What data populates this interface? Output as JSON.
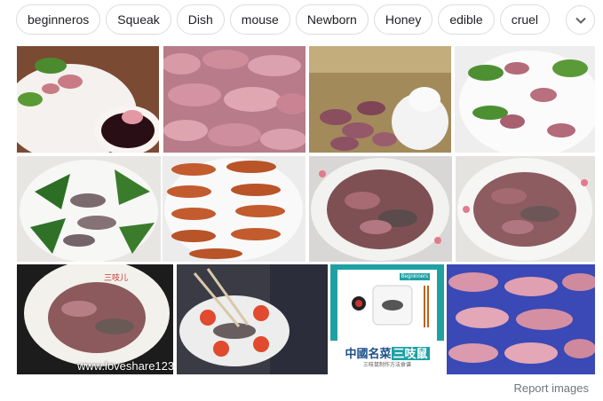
{
  "chips": [
    "beginneros",
    "Squeak",
    "Dish",
    "mouse",
    "Newborn",
    "Honey",
    "edible",
    "cruel"
  ],
  "expand_icon": "chevron-down-icon",
  "tiles": [
    {
      "id": "tile-1",
      "desc": "mice-on-plate-with-dipping-sauce"
    },
    {
      "id": "tile-2",
      "desc": "pile-of-pink-newborn-mice"
    },
    {
      "id": "tile-3",
      "desc": "newborn-mice-in-straw-nest"
    },
    {
      "id": "tile-4",
      "desc": "mice-on-plate-with-bok-choy"
    },
    {
      "id": "tile-5",
      "desc": "mice-on-leaves-platter"
    },
    {
      "id": "tile-6",
      "desc": "roasted-mice-rows"
    },
    {
      "id": "tile-7",
      "desc": "mice-on-floral-plate"
    },
    {
      "id": "tile-8",
      "desc": "mice-on-floral-plate-2"
    },
    {
      "id": "tile-9",
      "desc": "mice-dish-three-squeaks"
    },
    {
      "id": "tile-10",
      "desc": "chopsticks-holding-mouse"
    },
    {
      "id": "tile-11",
      "desc": "dish-package-graphic"
    },
    {
      "id": "tile-12",
      "desc": "pink-mice-on-blue-tray"
    }
  ],
  "watermark": "www.loveshare123",
  "package": {
    "brand": "Begninners",
    "title_prefix": "中國名菜",
    "title_highlight": "三吱鼠",
    "subtitle": "三吱鼠制作方法食谱"
  },
  "report_label": "Report images",
  "colors": {
    "chip_border": "#dadce0",
    "pink": "#d88a9a",
    "teal": "#1fa1a4"
  }
}
